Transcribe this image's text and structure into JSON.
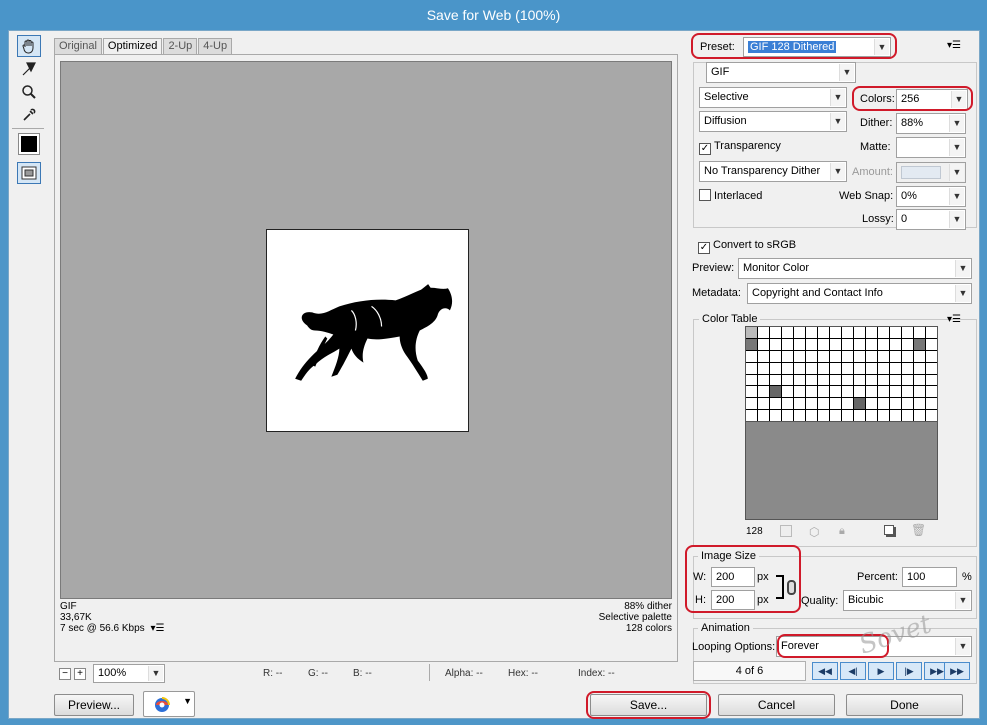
{
  "window": {
    "title": "Save for Web (100%)"
  },
  "tools": [
    {
      "name": "hand-tool-icon",
      "glyph": "✋"
    },
    {
      "name": "slice-select-tool-icon",
      "glyph": "⤡"
    },
    {
      "name": "zoom-tool-icon",
      "glyph": "🔍"
    },
    {
      "name": "eyedropper-tool-icon",
      "glyph": "✎"
    }
  ],
  "tabs": [
    "Original",
    "Optimized",
    "2-Up",
    "4-Up"
  ],
  "image_info": {
    "format": "GIF",
    "size": "33,67K",
    "download": "7 sec @ 56.6 Kbps",
    "dither": "88% dither",
    "palette": "Selective palette",
    "colors": "128 colors"
  },
  "bottom_bar": {
    "zoom": "100%",
    "r": "R: --",
    "g": "G: --",
    "b": "B: --",
    "alpha": "Alpha: --",
    "hex": "Hex: --",
    "index": "Index: --"
  },
  "preset": {
    "label": "Preset:",
    "value": "GIF 128 Dithered"
  },
  "settings": {
    "format": "GIF",
    "reduction": "Selective",
    "colors_label": "Colors:",
    "colors": "256",
    "dither_algo": "Diffusion",
    "dither_label": "Dither:",
    "dither": "88%",
    "transparency_label": "Transparency",
    "transparency_checked": true,
    "matte_label": "Matte:",
    "matte": "",
    "transparency_dither": "No Transparency Dither",
    "amount_label": "Amount:",
    "interlaced_label": "Interlaced",
    "interlaced_checked": false,
    "websnap_label": "Web Snap:",
    "websnap": "0%",
    "lossy_label": "Lossy:",
    "lossy": "0",
    "srgb_label": "Convert to sRGB",
    "srgb_checked": true,
    "preview_label": "Preview:",
    "preview": "Monitor Color",
    "metadata_label": "Metadata:",
    "metadata": "Copyright and Contact Info"
  },
  "color_table": {
    "title": "Color Table",
    "count": "128"
  },
  "image_size": {
    "title": "Image Size",
    "w_label": "W:",
    "w": "200",
    "h_label": "H:",
    "h": "200",
    "unit": "px",
    "percent_label": "Percent:",
    "percent": "100",
    "percent_unit": "%",
    "quality_label": "Quality:",
    "quality": "Bicubic"
  },
  "animation": {
    "title": "Animation",
    "looping_label": "Looping Options:",
    "looping": "Forever",
    "frame": "4 of 6"
  },
  "buttons": {
    "preview": "Preview...",
    "save": "Save...",
    "cancel": "Cancel",
    "done": "Done"
  },
  "watermark": "Sovet",
  "colors": {
    "accent": "#3a7fd5",
    "title_bar": "#4a95c9",
    "highlight_ring": "#d01a2a"
  }
}
